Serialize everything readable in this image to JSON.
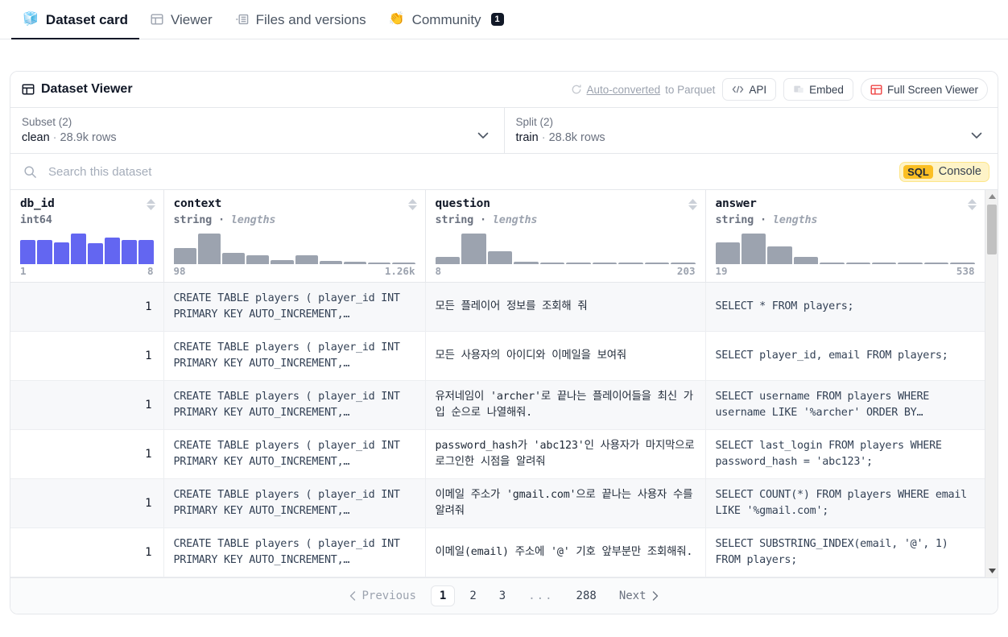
{
  "tabs": [
    {
      "label": "Dataset card",
      "icon": "cube-icon",
      "emoji": "🧊",
      "active": true
    },
    {
      "label": "Viewer",
      "icon": "table-icon",
      "active": false
    },
    {
      "label": "Files and versions",
      "icon": "files-icon",
      "active": false
    },
    {
      "label": "Community",
      "icon": "hand-clap-icon",
      "emoji": "👏",
      "active": false,
      "count": "1"
    }
  ],
  "viewer": {
    "title": "Dataset Viewer",
    "parquet_label": "Auto-converted to Parquet",
    "parquet_link_text": "Auto-converted",
    "parquet_rest_text": " to Parquet",
    "api_label": "API",
    "embed_label": "Embed",
    "fullscreen_label": "Full Screen Viewer"
  },
  "subset": {
    "label": "Subset (2)",
    "value": "clean",
    "rows": "28.9k rows"
  },
  "split": {
    "label": "Split (2)",
    "value": "train",
    "rows": "28.8k rows"
  },
  "search": {
    "placeholder": "Search this dataset",
    "value": "",
    "sql_tag": "SQL",
    "console_label": "Console"
  },
  "columns": [
    {
      "name": "db_id",
      "type": "int64",
      "type_suffix": "",
      "hist_color": "#6366f1",
      "hist": [
        78,
        78,
        72,
        100,
        68,
        88,
        78,
        80
      ],
      "min": "1",
      "max": "8",
      "sortable": true
    },
    {
      "name": "context",
      "type": "string · ",
      "type_suffix": "lengths",
      "hist_color": "#9ca3af",
      "hist": [
        52,
        100,
        38,
        30,
        12,
        28,
        10,
        8,
        6,
        6
      ],
      "min": "98",
      "max": "1.26k",
      "sortable": true
    },
    {
      "name": "question",
      "type": "string · ",
      "type_suffix": "lengths",
      "hist_color": "#9ca3af",
      "hist": [
        25,
        100,
        42,
        9,
        4,
        4,
        4,
        4,
        4,
        4
      ],
      "min": "8",
      "max": "203",
      "sortable": true
    },
    {
      "name": "answer",
      "type": "string · ",
      "type_suffix": "lengths",
      "hist_color": "#9ca3af",
      "hist": [
        72,
        100,
        58,
        25,
        6,
        4,
        4,
        4,
        4,
        4
      ],
      "min": "19",
      "max": "538",
      "sortable": true
    }
  ],
  "rows": [
    {
      "db_id": "1",
      "context": "CREATE TABLE players ( player_id INT PRIMARY KEY AUTO_INCREMENT,…",
      "question": "모든 플레이어 정보를 조회해 줘",
      "answer": "SELECT * FROM players;"
    },
    {
      "db_id": "1",
      "context": "CREATE TABLE players ( player_id INT PRIMARY KEY AUTO_INCREMENT,…",
      "question": "모든 사용자의 아이디와 이메일을 보여줘",
      "answer": "SELECT player_id, email FROM players;"
    },
    {
      "db_id": "1",
      "context": "CREATE TABLE players ( player_id INT PRIMARY KEY AUTO_INCREMENT,…",
      "question": "유저네임이 'archer'로 끝나는 플레이어들을 최신 가입 순으로 나열해줘.",
      "answer": "SELECT username FROM players WHERE username LIKE '%archer' ORDER BY…"
    },
    {
      "db_id": "1",
      "context": "CREATE TABLE players ( player_id INT PRIMARY KEY AUTO_INCREMENT,…",
      "question": "password_hash가 'abc123'인 사용자가 마지막으로 로그인한 시점을 알려줘",
      "answer": "SELECT last_login FROM players WHERE password_hash = 'abc123';"
    },
    {
      "db_id": "1",
      "context": "CREATE TABLE players ( player_id INT PRIMARY KEY AUTO_INCREMENT,…",
      "question": "이메일 주소가 'gmail.com'으로 끝나는 사용자 수를 알려줘",
      "answer": "SELECT COUNT(*) FROM players WHERE email LIKE '%gmail.com';"
    },
    {
      "db_id": "1",
      "context": "CREATE TABLE players ( player_id INT PRIMARY KEY AUTO_INCREMENT,…",
      "question": "이메일(email) 주소에 '@' 기호 앞부분만 조회해줘.",
      "answer": "SELECT SUBSTRING_INDEX(email, '@', 1) FROM players;"
    }
  ],
  "pagination": {
    "previous": "Previous",
    "next": "Next",
    "pages": [
      "1",
      "2",
      "3"
    ],
    "ellipsis": "...",
    "last": "288",
    "current": "1"
  },
  "colors": {
    "accent_indigo": "#6366f1",
    "hist_gray": "#9ca3af",
    "red": "#ef4444",
    "sql_yellow": "#fbbf24",
    "sql_bg": "#fef3c7"
  }
}
